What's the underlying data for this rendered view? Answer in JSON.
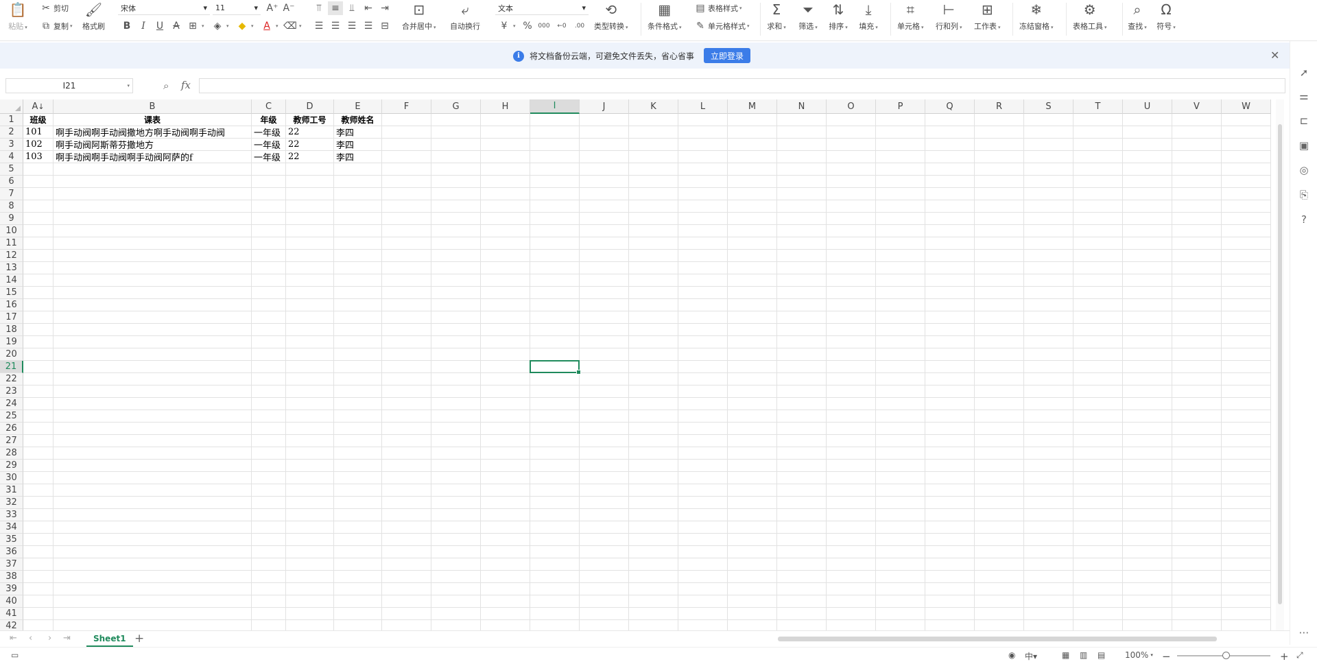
{
  "ribbon": {
    "paste": "粘贴",
    "cut": "剪切",
    "copy": "复制",
    "format_painter": "格式刷",
    "font_name": "宋体",
    "font_size": "11",
    "merge_center": "合并居中",
    "auto_wrap": "自动换行",
    "number_format": "文本",
    "type_convert": "类型转换",
    "cond_format": "条件格式",
    "table_style": "表格样式",
    "cell_style": "单元格样式",
    "sum": "求和",
    "filter": "筛选",
    "sort": "排序",
    "fill": "填充",
    "cell": "单元格",
    "row_col": "行和列",
    "worksheet": "工作表",
    "freeze": "冻结窗格",
    "table_tools": "表格工具",
    "find": "查找",
    "symbol": "符号",
    "percent": "%",
    "thousands": "000"
  },
  "banner": {
    "message": "将文档备份云端，可避免文件丢失，省心省事",
    "login_button": "立即登录"
  },
  "formula_bar": {
    "name_box": "I21",
    "fx": "fx",
    "formula": ""
  },
  "columns": [
    "A",
    "B",
    "C",
    "D",
    "E",
    "F",
    "G",
    "H",
    "I",
    "J",
    "K",
    "L",
    "M",
    "N",
    "O",
    "P",
    "Q",
    "R",
    "S",
    "T",
    "U",
    "V",
    "W"
  ],
  "sort_indicator": "↓",
  "selected_cell": {
    "col": "I",
    "row": 21
  },
  "table": {
    "headers": [
      "班级",
      "课表",
      "年级",
      "教师工号",
      "教师姓名"
    ],
    "rows": [
      [
        "101",
        "啊手动阀啊手动阀撒地方啊手动阀啊手动阀",
        "一年级",
        "22",
        "李四"
      ],
      [
        "102",
        "啊手动阀阿斯蒂芬撒地方",
        "一年级",
        "22",
        "李四"
      ],
      [
        "103",
        "啊手动阀啊手动阀啊手动阀阿萨的f",
        "一年级",
        "22",
        "李四"
      ]
    ]
  },
  "sheets": [
    "Sheet1"
  ],
  "status": {
    "zoom": "100%"
  }
}
